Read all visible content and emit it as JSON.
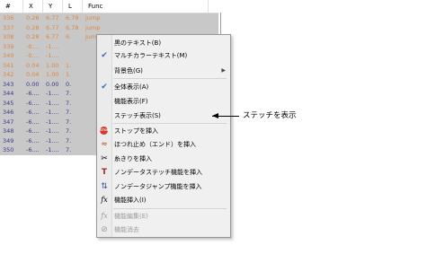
{
  "grid": {
    "headers": [
      "#",
      "X",
      "Y",
      "L",
      "Func"
    ],
    "rows": [
      {
        "cells": [
          "336",
          "0.28",
          "6.77",
          "6.78",
          "jump"
        ],
        "color": "#e2873a"
      },
      {
        "cells": [
          "337",
          "0.28",
          "6.77",
          "6.78",
          "jump"
        ],
        "color": "#e2873a"
      },
      {
        "cells": [
          "338",
          "0.28",
          "6.77",
          "6.",
          "jump"
        ],
        "color": "#e2873a"
      },
      {
        "cells": [
          "339",
          "-0....",
          "-1....",
          "",
          ""
        ],
        "color": "#e2873a"
      },
      {
        "cells": [
          "340",
          "-0....",
          "-1....",
          "",
          ""
        ],
        "color": "#e2873a"
      },
      {
        "cells": [
          "341",
          "0.04",
          "1.00",
          "1.",
          ""
        ],
        "color": "#e2873a"
      },
      {
        "cells": [
          "342",
          "0.04",
          "1.00",
          "1.",
          ""
        ],
        "color": "#e2873a"
      },
      {
        "cells": [
          "343",
          "0.00",
          "0.00",
          "0.",
          ""
        ],
        "color": "#3a3a8a"
      },
      {
        "cells": [
          "344",
          "-6....",
          "-1....",
          "7.",
          ""
        ],
        "color": "#3a3a8a"
      },
      {
        "cells": [
          "345",
          "-6....",
          "-1....",
          "7.",
          ""
        ],
        "color": "#3a3a8a"
      },
      {
        "cells": [
          "346",
          "-6....",
          "-1....",
          "7.",
          ""
        ],
        "color": "#3a3a8a"
      },
      {
        "cells": [
          "347",
          "-6....",
          "-1....",
          "7.",
          ""
        ],
        "color": "#3a3a8a"
      },
      {
        "cells": [
          "348",
          "-6....",
          "-1....",
          "7.",
          ""
        ],
        "color": "#3a3a8a"
      },
      {
        "cells": [
          "349",
          "-6....",
          "-1....",
          "7.",
          ""
        ],
        "color": "#3a3a8a"
      },
      {
        "cells": [
          "350",
          "-6....",
          "-1....",
          "7.",
          ""
        ],
        "color": "#3a3a8a"
      }
    ]
  },
  "menu": {
    "items": [
      {
        "label": "黒のテキスト(B)",
        "icon": "",
        "enabled": true
      },
      {
        "label": "マルチカラーテキスト(M)",
        "icon": "check",
        "enabled": true
      },
      {
        "label": "背景色(G)",
        "icon": "",
        "enabled": true,
        "submenu": "▶"
      },
      {
        "label": "全体表示(A)",
        "icon": "check",
        "enabled": true
      },
      {
        "label": "機能表示(F)",
        "icon": "",
        "enabled": true
      },
      {
        "label": "ステッチ表示(S)",
        "icon": "",
        "enabled": true
      },
      {
        "label": "ストップを挿入",
        "icon": "stop-icon",
        "icon_text": "STOP",
        "enabled": true
      },
      {
        "label": "ほつれ止め（エンド）を挿入",
        "icon": "tieoff-icon",
        "icon_text": "≈",
        "enabled": true
      },
      {
        "label": "糸きりを挿入",
        "icon": "trim-icon",
        "icon_text": "✂",
        "enabled": true
      },
      {
        "label": "ノンデータステッチ機能を挿入",
        "icon": "nondata-stitch-icon",
        "icon_text": "T",
        "enabled": true
      },
      {
        "label": "ノンデータジャンプ機能を挿入",
        "icon": "nondata-jump-icon",
        "icon_text": "⇅",
        "enabled": true
      },
      {
        "label": "機能挿入(I)",
        "icon": "function-icon",
        "icon_text": "fx",
        "enabled": true
      },
      {
        "label": "機能編集(E)",
        "icon": "function-edit-icon",
        "icon_text": "fx",
        "enabled": false
      },
      {
        "label": "機能消去",
        "icon": "function-delete-icon",
        "icon_text": "⊘",
        "enabled": false
      }
    ],
    "check_glyph": "✔"
  },
  "callout": {
    "text": "ステッチを表示"
  },
  "colors": {
    "grid_bg": "#c8c8c8",
    "orange_rows": "#e2873a",
    "blue_rows": "#3a3a8a",
    "menu_bg": "#f0f0f0"
  }
}
